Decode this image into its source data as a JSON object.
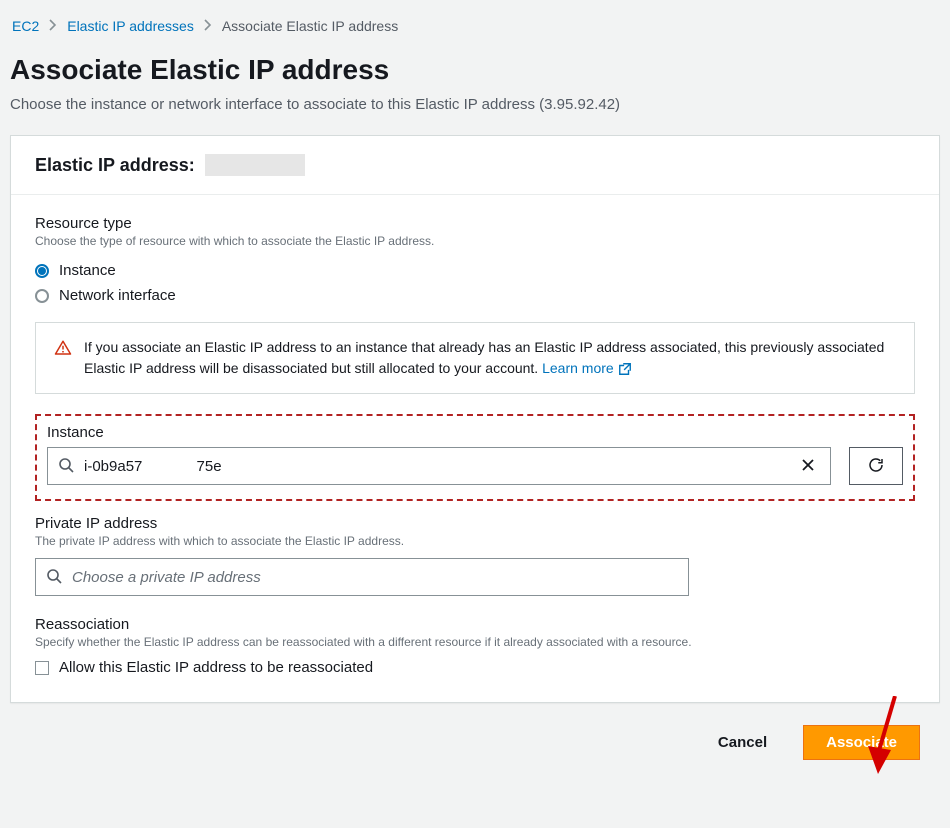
{
  "breadcrumb": {
    "root": "EC2",
    "parent": "Elastic IP addresses",
    "current": "Associate Elastic IP address"
  },
  "page": {
    "title": "Associate Elastic IP address",
    "description": "Choose the instance or network interface to associate to this Elastic IP address (3.95.92.42)"
  },
  "panel": {
    "eip_label": "Elastic IP address:"
  },
  "resource_type": {
    "label": "Resource type",
    "help": "Choose the type of resource with which to associate the Elastic IP address.",
    "options": {
      "instance": "Instance",
      "network_interface": "Network interface"
    }
  },
  "alert": {
    "text": "If you associate an Elastic IP address to an instance that already has an Elastic IP address associated, this previously associated Elastic IP address will be disassociated but still allocated to your account. ",
    "learn_more": "Learn more"
  },
  "instance": {
    "label": "Instance",
    "value": "i-0b9a57             75e"
  },
  "private_ip": {
    "label": "Private IP address",
    "help": "The private IP address with which to associate the Elastic IP address.",
    "placeholder": "Choose a private IP address"
  },
  "reassociation": {
    "label": "Reassociation",
    "help": "Specify whether the Elastic IP address can be reassociated with a different resource if it already associated with a resource.",
    "checkbox_label": "Allow this Elastic IP address to be reassociated"
  },
  "footer": {
    "cancel": "Cancel",
    "associate": "Associate"
  }
}
